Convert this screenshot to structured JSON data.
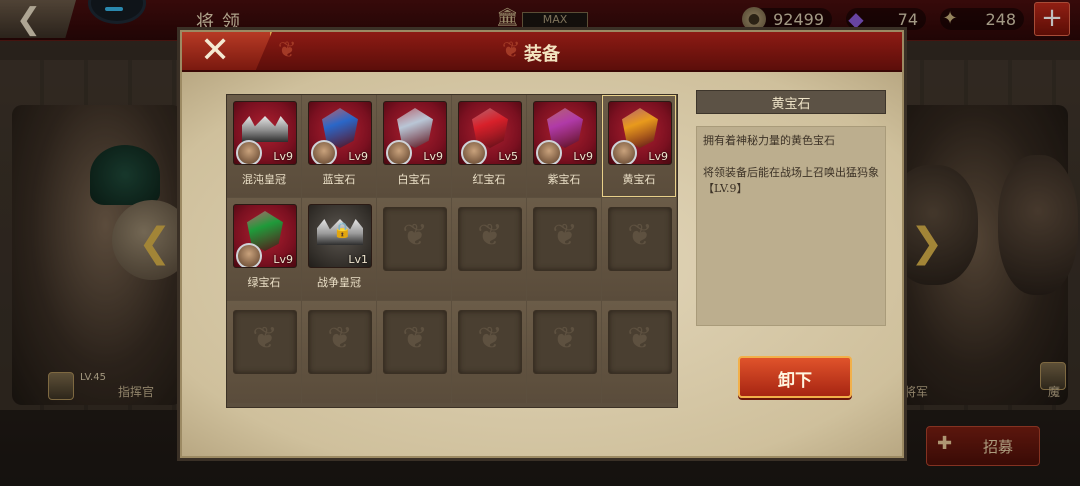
{
  "topbar": {
    "screen_title": "将领",
    "power_label": "MAX",
    "gold": "92499",
    "gems": "74",
    "tickets": "248",
    "add_symbol": "+",
    "back_symbol": "❮"
  },
  "background": {
    "left_hero_level": "LV.45",
    "left_hero_name": "指挥官",
    "right_hero_name": "将军",
    "right_hero_tag": "魔"
  },
  "recruit": {
    "label": "招募",
    "icon": "plus-helmet-icon"
  },
  "modal": {
    "title": "装备",
    "close_symbol": "✕",
    "items": [
      {
        "name": "混沌皇冠",
        "level": "Lv9",
        "type": "crown",
        "color": "#8d8d8d"
      },
      {
        "name": "蓝宝石",
        "level": "Lv9",
        "type": "gem",
        "color": "#2a67c8"
      },
      {
        "name": "白宝石",
        "level": "Lv9",
        "type": "gem",
        "color": "#b9c6d6"
      },
      {
        "name": "红宝石",
        "level": "Lv5",
        "type": "gem",
        "color": "#d8202a"
      },
      {
        "name": "紫宝石",
        "level": "Lv9",
        "type": "gem",
        "color": "#b03aa8"
      },
      {
        "name": "黄宝石",
        "level": "Lv9",
        "type": "gem",
        "color": "#e89a1c",
        "selected": true
      },
      {
        "name": "绿宝石",
        "level": "Lv9",
        "type": "gem",
        "color": "#1f9a3a"
      },
      {
        "name": "战争皇冠",
        "level": "Lv1",
        "type": "locked-crown",
        "color": "#9c9c9c"
      }
    ],
    "detail": {
      "title": "黄宝石",
      "description": "拥有着神秘力量的黄色宝石",
      "effect": "将领装备后能在战场上召唤出猛犸象【LV.9】"
    },
    "unequip_label": "卸下"
  }
}
